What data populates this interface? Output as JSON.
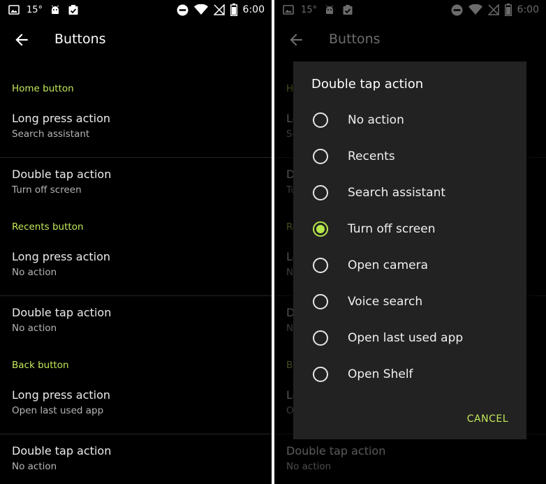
{
  "status_bar": {
    "temperature": "15°",
    "time": "6:00"
  },
  "toolbar": {
    "title": "Buttons"
  },
  "colors": {
    "accent": "#c3e85a",
    "background": "#000000",
    "dialog_bg": "#222222"
  },
  "sections": [
    {
      "header": "Home button",
      "items": [
        {
          "title": "Long press action",
          "summary": "Search assistant"
        },
        {
          "title": "Double tap action",
          "summary": "Turn off screen"
        }
      ]
    },
    {
      "header": "Recents button",
      "items": [
        {
          "title": "Long press action",
          "summary": "No action"
        },
        {
          "title": "Double tap action",
          "summary": "No action"
        }
      ]
    },
    {
      "header": "Back button",
      "items": [
        {
          "title": "Long press action",
          "summary": "Open last used app"
        },
        {
          "title": "Double tap action",
          "summary": "No action"
        }
      ]
    }
  ],
  "dialog": {
    "title": "Double tap action",
    "options": [
      {
        "label": "No action",
        "selected": false
      },
      {
        "label": "Recents",
        "selected": false
      },
      {
        "label": "Search assistant",
        "selected": false
      },
      {
        "label": "Turn off screen",
        "selected": true
      },
      {
        "label": "Open camera",
        "selected": false
      },
      {
        "label": "Voice search",
        "selected": false
      },
      {
        "label": "Open last used app",
        "selected": false
      },
      {
        "label": "Open Shelf",
        "selected": false
      }
    ],
    "cancel_label": "CANCEL"
  },
  "icons": [
    "image-icon",
    "android-icon",
    "clipboard-check-icon",
    "dnd-icon",
    "wifi-icon",
    "no-sim-icon",
    "battery-icon",
    "arrow-back-icon"
  ]
}
